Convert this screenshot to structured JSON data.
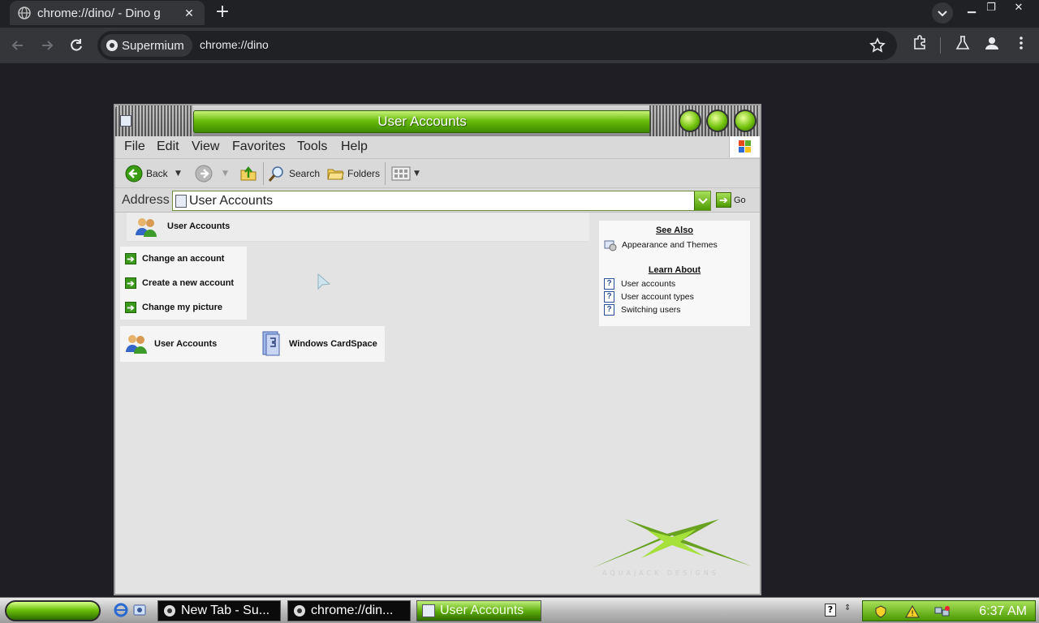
{
  "browser": {
    "tab_title": "chrome://dino/ - Dino g",
    "site_chip": "Supermium",
    "url": "chrome://dino"
  },
  "window": {
    "title": "User Accounts",
    "menus": [
      "File",
      "Edit",
      "View",
      "Favorites",
      "Tools",
      "Help"
    ],
    "toolbar": {
      "back": "Back",
      "search": "Search",
      "folders": "Folders"
    },
    "address": {
      "label": "Address",
      "value": "User Accounts",
      "go": "Go"
    }
  },
  "content": {
    "header": "User Accounts",
    "tasks": [
      "Change an account",
      "Create a new account",
      "Change my picture"
    ],
    "control_panel_items": [
      "User Accounts",
      "Windows CardSpace"
    ],
    "see_also": {
      "heading": "See Also",
      "items": [
        "Appearance and Themes"
      ]
    },
    "learn_about": {
      "heading": "Learn About",
      "items": [
        "User accounts",
        "User account types",
        "Switching users"
      ]
    },
    "watermark": "AQUAJACK DESIGNS"
  },
  "taskbar": {
    "buttons": [
      "New Tab - Su...",
      "chrome://din...",
      "User Accounts"
    ],
    "clock": "6:37 AM"
  },
  "colors": {
    "accent_green": "#6abd0c",
    "chrome_dark": "#202124"
  }
}
